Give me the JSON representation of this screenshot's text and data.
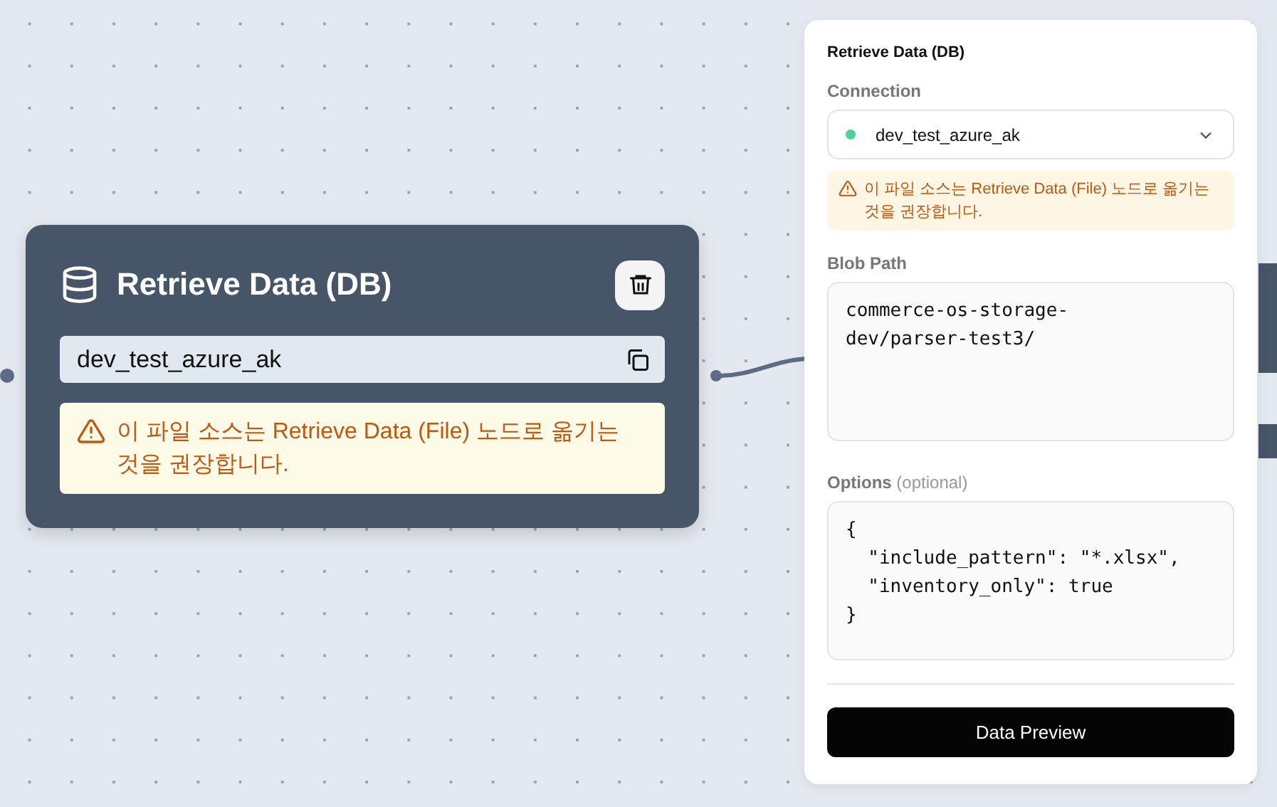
{
  "node": {
    "title": "Retrieve Data (DB)",
    "connection": "dev_test_azure_ak",
    "warning": "이 파일 소스는 Retrieve Data (File) 노드로 옮기는 것을 권장합니다."
  },
  "panel": {
    "title": "Retrieve Data (DB)",
    "connection": {
      "label": "Connection",
      "value": "dev_test_azure_ak"
    },
    "warning": "이 파일 소스는 Retrieve Data (File) 노드로 옮기는 것을 권장합니다.",
    "blob_path": {
      "label": "Blob Path",
      "value": "commerce-os-storage-\ndev/parser-test3/"
    },
    "options": {
      "label": "Options",
      "hint": "(optional)",
      "value": "{\n  \"include_pattern\": \"*.xlsx\",\n  \"inventory_only\": true\n}"
    },
    "button": "Data Preview"
  }
}
